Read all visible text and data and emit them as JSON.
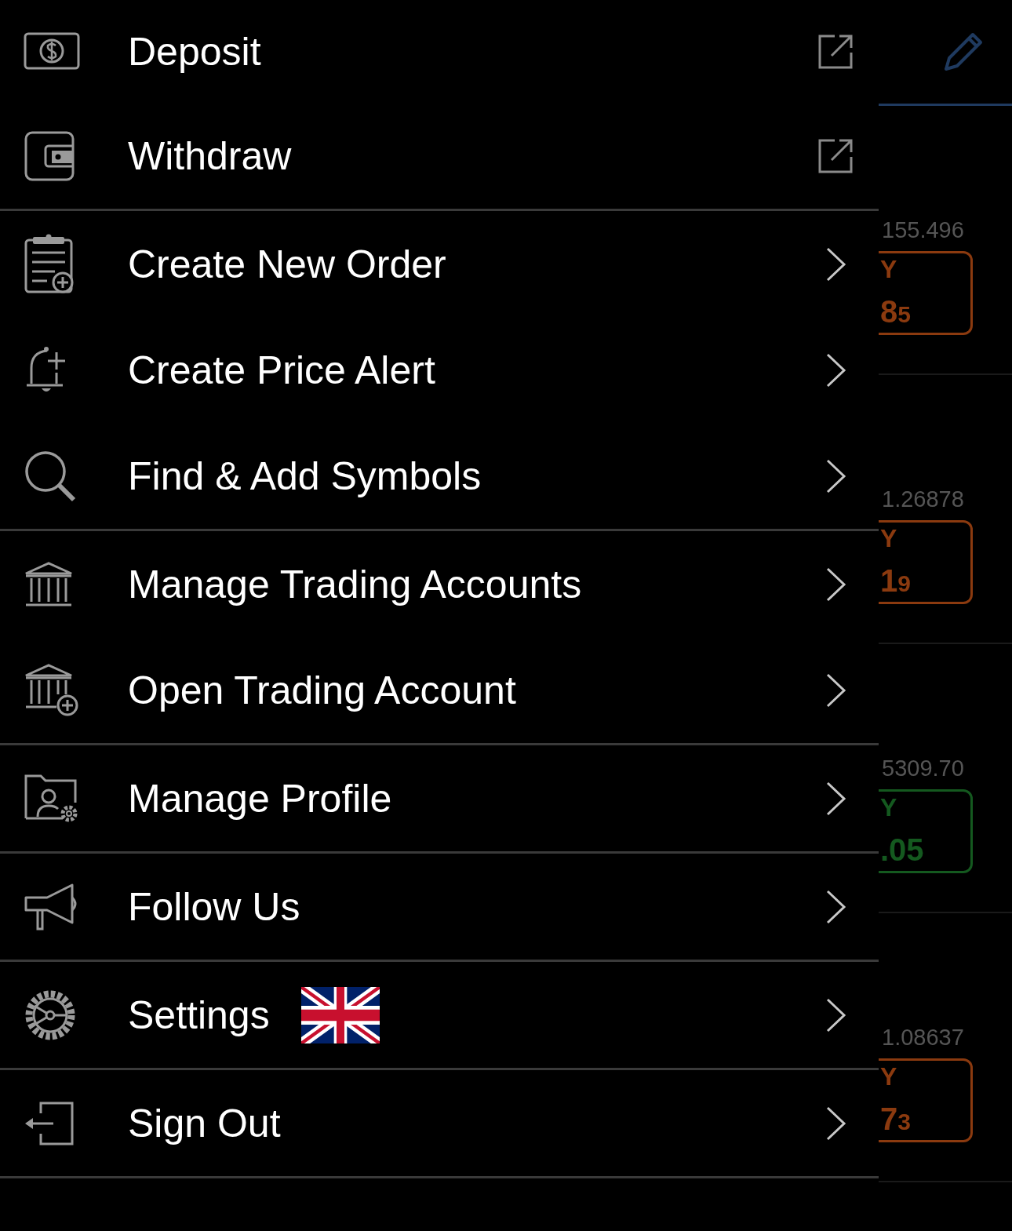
{
  "menu": {
    "sections": [
      {
        "items": [
          {
            "label": "Deposit",
            "kind": "external"
          },
          {
            "label": "Withdraw",
            "kind": "external"
          }
        ]
      },
      {
        "items": [
          {
            "label": "Create New Order",
            "kind": "chevron"
          },
          {
            "label": "Create Price Alert",
            "kind": "chevron"
          },
          {
            "label": "Find & Add Symbols",
            "kind": "chevron"
          }
        ]
      },
      {
        "items": [
          {
            "label": "Manage Trading Accounts",
            "kind": "chevron"
          },
          {
            "label": "Open Trading Account",
            "kind": "chevron"
          }
        ]
      },
      {
        "items": [
          {
            "label": "Manage Profile",
            "kind": "chevron"
          }
        ]
      },
      {
        "items": [
          {
            "label": "Follow Us",
            "kind": "chevron"
          }
        ]
      },
      {
        "items": [
          {
            "label": "Settings",
            "kind": "language"
          }
        ]
      },
      {
        "items": [
          {
            "label": "Sign Out",
            "kind": "chevron"
          }
        ]
      }
    ]
  },
  "quotes": [
    {
      "price": "155.496",
      "side": "Y",
      "big": "8",
      "small": "5",
      "color": "#8b3a0f"
    },
    {
      "price": "1.26878",
      "side": "Y",
      "big": "1",
      "small": "9",
      "color": "#8b3a0f"
    },
    {
      "price": "5309.70",
      "side": "Y",
      "big": ".05",
      "color": "#14591f"
    },
    {
      "price": "1.08637",
      "side": "Y",
      "big": "7",
      "small": "3",
      "color": "#8b3a0f"
    }
  ]
}
